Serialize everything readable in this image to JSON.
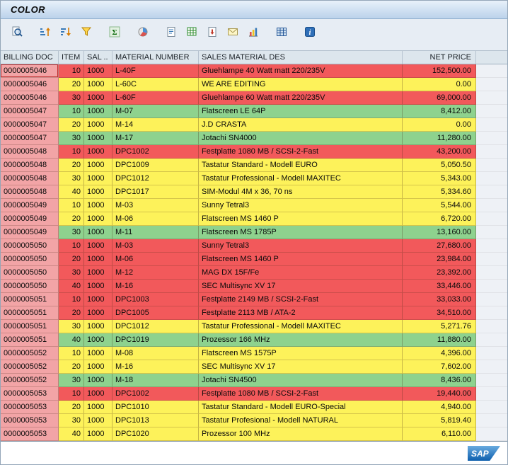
{
  "window": {
    "title": "COLOR"
  },
  "toolbar": {
    "buttons": [
      {
        "name": "details"
      },
      {
        "name": "sort-ascending"
      },
      {
        "name": "sort-descending"
      },
      {
        "name": "set-filter"
      },
      {
        "name": "total"
      },
      {
        "name": "subtotal"
      },
      {
        "name": "word-processing"
      },
      {
        "name": "spreadsheet"
      },
      {
        "name": "local-file"
      },
      {
        "name": "mail-recipient"
      },
      {
        "name": "graphic"
      },
      {
        "name": "choose-layout"
      },
      {
        "name": "information"
      }
    ]
  },
  "colors": {
    "row_red": "#f2595b",
    "row_yellow": "#fdf25a",
    "row_green": "#8ed28e",
    "key_column": "#f2a4a6",
    "header_bg": "#dde6ed",
    "toolbar_bg": "#e7edf4",
    "logo_blue": "#0d5fae"
  },
  "table": {
    "columns": [
      {
        "key": "billing_doc",
        "label": "BILLING DOC",
        "align": "left",
        "header_align": "left"
      },
      {
        "key": "item",
        "label": "ITEM",
        "align": "right",
        "header_align": "left"
      },
      {
        "key": "sal",
        "label": "SAL ..",
        "align": "left",
        "header_align": "left"
      },
      {
        "key": "material_number",
        "label": "MATERIAL NUMBER",
        "align": "left",
        "header_align": "left"
      },
      {
        "key": "description",
        "label": "SALES MATERIAL DES",
        "align": "left",
        "header_align": "left"
      },
      {
        "key": "net_price",
        "label": "NET PRICE",
        "align": "right",
        "header_align": "right"
      }
    ],
    "rows": [
      {
        "billing_doc": "0000005046",
        "item": "10",
        "sal": "1000",
        "material_number": "L-40F",
        "description": "Gluehlampe 40 Watt matt 220/235V",
        "net_price": "152,500.00",
        "color": "red"
      },
      {
        "billing_doc": "0000005046",
        "item": "20",
        "sal": "1000",
        "material_number": "L-60C",
        "description": "WE ARE EDITING",
        "net_price": "0.00",
        "color": "yellow"
      },
      {
        "billing_doc": "0000005046",
        "item": "30",
        "sal": "1000",
        "material_number": "L-60F",
        "description": "Gluehlampe 60 Watt matt 220/235V",
        "net_price": "69,000.00",
        "color": "red"
      },
      {
        "billing_doc": "0000005047",
        "item": "10",
        "sal": "1000",
        "material_number": "M-07",
        "description": "Flatscreen LE 64P",
        "net_price": "8,412.00",
        "color": "green"
      },
      {
        "billing_doc": "0000005047",
        "item": "20",
        "sal": "1000",
        "material_number": "M-14",
        "description": "J.D CRASTA",
        "net_price": "0.00",
        "color": "yellow"
      },
      {
        "billing_doc": "0000005047",
        "item": "30",
        "sal": "1000",
        "material_number": "M-17",
        "description": "Jotachi SN4000",
        "net_price": "11,280.00",
        "color": "green"
      },
      {
        "billing_doc": "0000005048",
        "item": "10",
        "sal": "1000",
        "material_number": "DPC1002",
        "description": "Festplatte 1080 MB / SCSI-2-Fast",
        "net_price": "43,200.00",
        "color": "red"
      },
      {
        "billing_doc": "0000005048",
        "item": "20",
        "sal": "1000",
        "material_number": "DPC1009",
        "description": "Tastatur Standard - Modell EURO",
        "net_price": "5,050.50",
        "color": "yellow"
      },
      {
        "billing_doc": "0000005048",
        "item": "30",
        "sal": "1000",
        "material_number": "DPC1012",
        "description": "Tastatur Professional - Modell MAXITEC",
        "net_price": "5,343.00",
        "color": "yellow"
      },
      {
        "billing_doc": "0000005048",
        "item": "40",
        "sal": "1000",
        "material_number": "DPC1017",
        "description": "SIM-Modul 4M x 36, 70 ns",
        "net_price": "5,334.60",
        "color": "yellow"
      },
      {
        "billing_doc": "0000005049",
        "item": "10",
        "sal": "1000",
        "material_number": "M-03",
        "description": "Sunny Tetral3",
        "net_price": "5,544.00",
        "color": "yellow"
      },
      {
        "billing_doc": "0000005049",
        "item": "20",
        "sal": "1000",
        "material_number": "M-06",
        "description": "Flatscreen MS 1460 P",
        "net_price": "6,720.00",
        "color": "yellow"
      },
      {
        "billing_doc": "0000005049",
        "item": "30",
        "sal": "1000",
        "material_number": "M-11",
        "description": "Flatscreen MS 1785P",
        "net_price": "13,160.00",
        "color": "green"
      },
      {
        "billing_doc": "0000005050",
        "item": "10",
        "sal": "1000",
        "material_number": "M-03",
        "description": "Sunny Tetral3",
        "net_price": "27,680.00",
        "color": "red"
      },
      {
        "billing_doc": "0000005050",
        "item": "20",
        "sal": "1000",
        "material_number": "M-06",
        "description": "Flatscreen MS 1460 P",
        "net_price": "23,984.00",
        "color": "red"
      },
      {
        "billing_doc": "0000005050",
        "item": "30",
        "sal": "1000",
        "material_number": "M-12",
        "description": "MAG DX 15F/Fe",
        "net_price": "23,392.00",
        "color": "red"
      },
      {
        "billing_doc": "0000005050",
        "item": "40",
        "sal": "1000",
        "material_number": "M-16",
        "description": "SEC Multisync XV 17",
        "net_price": "33,446.00",
        "color": "red"
      },
      {
        "billing_doc": "0000005051",
        "item": "10",
        "sal": "1000",
        "material_number": "DPC1003",
        "description": "Festplatte 2149 MB / SCSI-2-Fast",
        "net_price": "33,033.00",
        "color": "red"
      },
      {
        "billing_doc": "0000005051",
        "item": "20",
        "sal": "1000",
        "material_number": "DPC1005",
        "description": "Festplatte 2113 MB / ATA-2",
        "net_price": "34,510.00",
        "color": "red"
      },
      {
        "billing_doc": "0000005051",
        "item": "30",
        "sal": "1000",
        "material_number": "DPC1012",
        "description": "Tastatur Professional - Modell MAXITEC",
        "net_price": "5,271.76",
        "color": "yellow"
      },
      {
        "billing_doc": "0000005051",
        "item": "40",
        "sal": "1000",
        "material_number": "DPC1019",
        "description": "Prozessor 166 MHz",
        "net_price": "11,880.00",
        "color": "green"
      },
      {
        "billing_doc": "0000005052",
        "item": "10",
        "sal": "1000",
        "material_number": "M-08",
        "description": "Flatscreen MS 1575P",
        "net_price": "4,396.00",
        "color": "yellow"
      },
      {
        "billing_doc": "0000005052",
        "item": "20",
        "sal": "1000",
        "material_number": "M-16",
        "description": "SEC Multisync XV 17",
        "net_price": "7,602.00",
        "color": "yellow"
      },
      {
        "billing_doc": "0000005052",
        "item": "30",
        "sal": "1000",
        "material_number": "M-18",
        "description": "Jotachi SN4500",
        "net_price": "8,436.00",
        "color": "green"
      },
      {
        "billing_doc": "0000005053",
        "item": "10",
        "sal": "1000",
        "material_number": "DPC1002",
        "description": "Festplatte 1080 MB / SCSI-2-Fast",
        "net_price": "19,440.00",
        "color": "red"
      },
      {
        "billing_doc": "0000005053",
        "item": "20",
        "sal": "1000",
        "material_number": "DPC1010",
        "description": "Tastatur Standard - Modell EURO-Special",
        "net_price": "4,940.00",
        "color": "yellow"
      },
      {
        "billing_doc": "0000005053",
        "item": "30",
        "sal": "1000",
        "material_number": "DPC1013",
        "description": "Tastatur Profesional - Modell NATURAL",
        "net_price": "5,819.40",
        "color": "yellow"
      },
      {
        "billing_doc": "0000005053",
        "item": "40",
        "sal": "1000",
        "material_number": "DPC1020",
        "description": "Prozessor 100 MHz",
        "net_price": "6,110.00",
        "color": "yellow"
      }
    ]
  },
  "footer": {
    "logo_text": "SAP"
  }
}
